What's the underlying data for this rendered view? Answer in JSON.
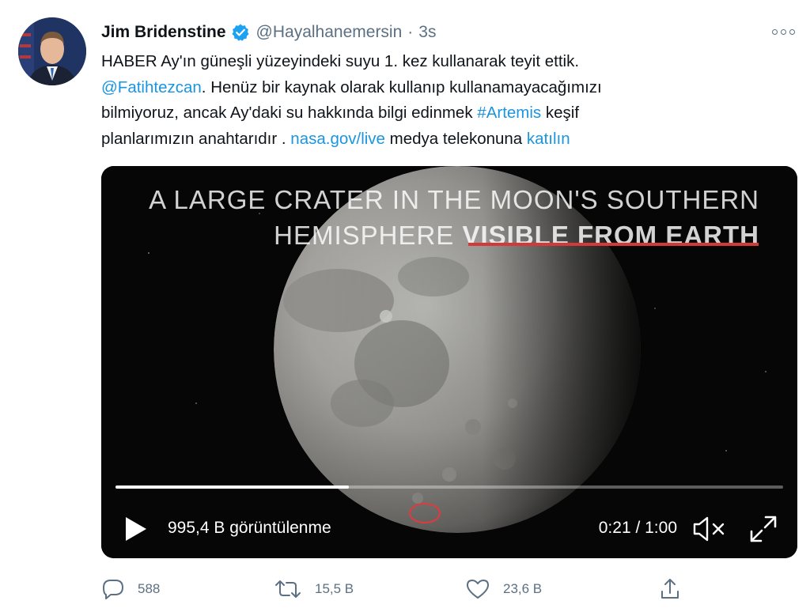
{
  "tweet": {
    "author": {
      "name": "Jim Bridenstine",
      "handle": "@Hayalhanemersin",
      "separator": "·",
      "time": "3s"
    },
    "text": {
      "line1": "HABER Ay'ın güneşli yüzeyindeki suyu 1. kez kullanarak teyit ettik.",
      "mention": "@Fatihtezcan",
      "line2_rest": ". Henüz bir kaynak olarak kullanıp kullanamayacağımızı",
      "line3_start": "bilmiyoruz, ancak Ay'daki su hakkında bilgi edinmek ",
      "hashtag": "#Artemis",
      "line3_end": " keşif",
      "line4_start": "planlarımızın anahtarıdır .  ",
      "url": "nasa.gov/live",
      "line4_mid": "  medya telekonuna ",
      "join_link": "katılın"
    },
    "video": {
      "caption_line1": "A LARGE CRATER IN THE MOON'S SOUTHERN",
      "caption_line2_light": "HEMISPHERE ",
      "caption_line2_bold": "VISIBLE FROM EARTH",
      "views": "995,4 B görüntülenme",
      "timecode": "0:21 / 1:00",
      "progress_fraction": 0.35
    },
    "actions": {
      "replies": "588",
      "retweets": "15,5 B",
      "likes": "23,6 B"
    },
    "colors": {
      "link": "#1b95e0",
      "secondary_text": "#5b7083",
      "verified_badge": "#1da1f2",
      "caption_underline": "#d23a3a"
    },
    "icons": [
      "verified-badge-icon",
      "more-icon",
      "play-icon",
      "mute-icon",
      "fullscreen-icon",
      "reply-icon",
      "retweet-icon",
      "like-icon",
      "share-icon"
    ]
  }
}
